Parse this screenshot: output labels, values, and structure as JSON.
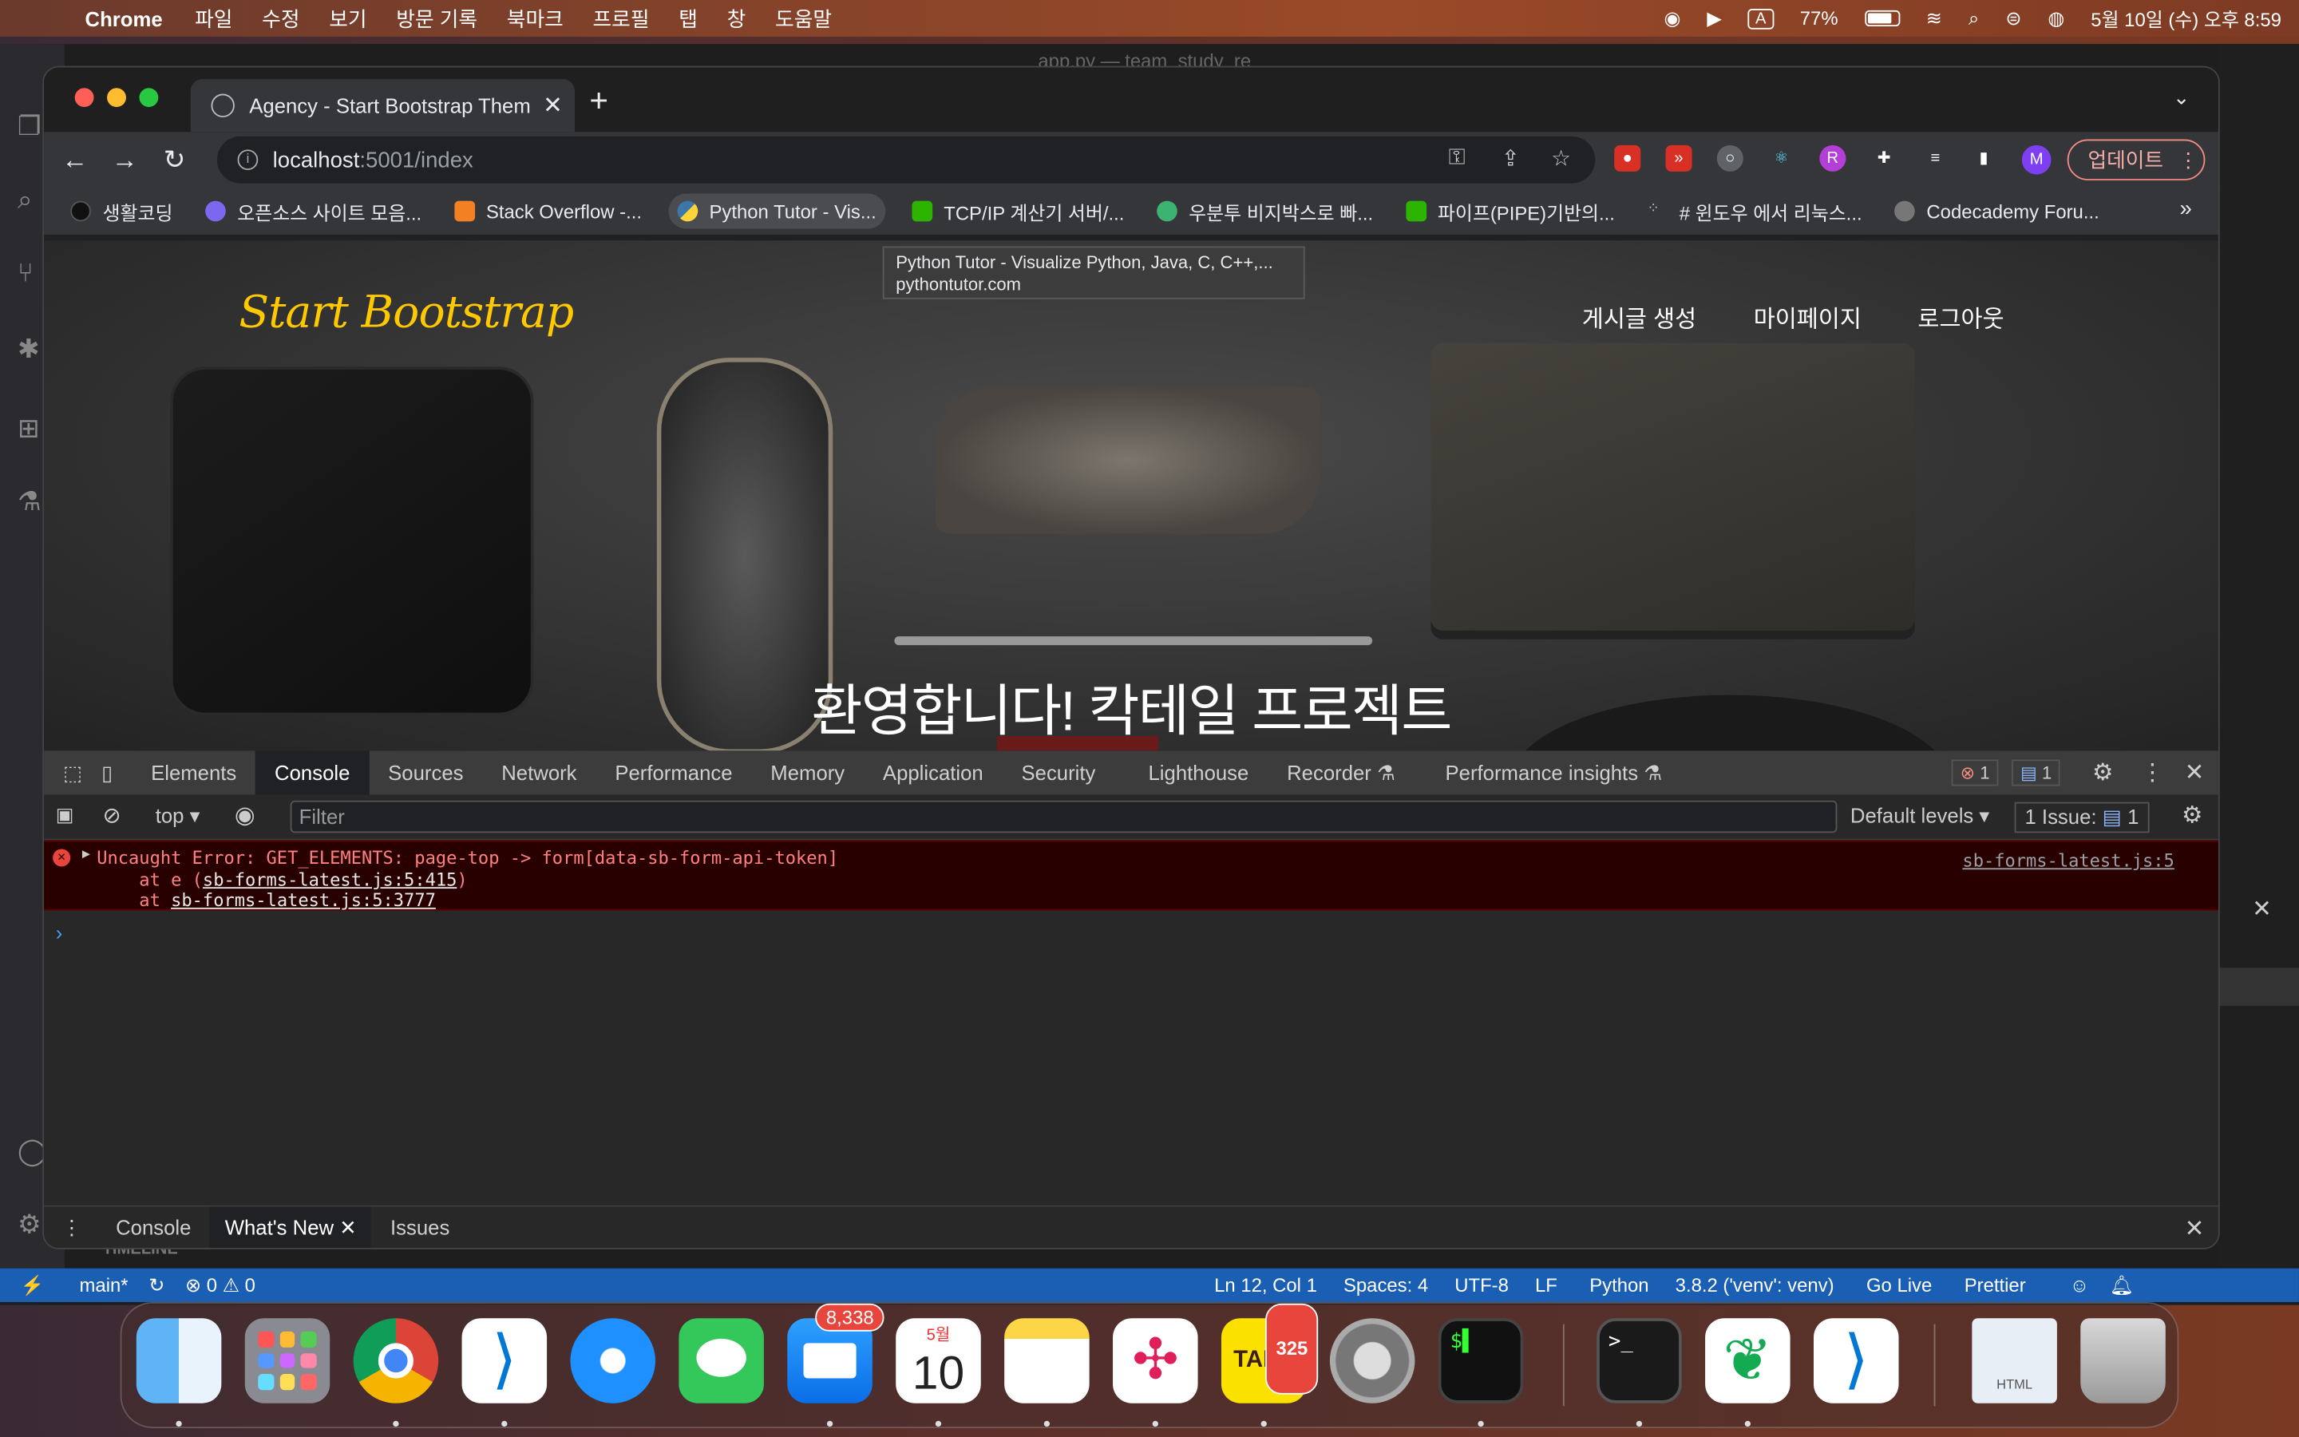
{
  "menubar": {
    "app": "Chrome",
    "items": [
      "파일",
      "수정",
      "보기",
      "방문 기록",
      "북마크",
      "프로필",
      "탭",
      "창",
      "도움말"
    ],
    "battery": "77%",
    "input": "A",
    "datetime": "5월 10일 (수) 오후 8:59"
  },
  "vscode": {
    "title": "app.py — team_study_re",
    "timeline": "TIMELINE",
    "status": {
      "branch": "main*",
      "problems": "⊗ 0 ⚠ 0",
      "position": "Ln 12, Col 1",
      "spaces": "Spaces: 4",
      "encoding": "UTF-8",
      "eol": "LF",
      "language": "Python",
      "interpreter": "3.8.2 ('venv': venv)",
      "golive": "Go Live",
      "prettier": "Prettier"
    }
  },
  "chrome": {
    "tab_title": "Agency - Start Bootstrap Them",
    "url_host": "localhost",
    "url_path": ":5001/index",
    "update": "업데이트",
    "profile": "M",
    "bookmarks": [
      "생활코딩",
      "오픈소스 사이트 모음...",
      "Stack Overflow -...",
      "Python Tutor - Vis...",
      "TCP/IP 계산기 서버/...",
      "우분투 비지박스로 빠...",
      "파이프(PIPE)기반의...",
      "# 윈도우 에서 리눅스...",
      "Codecademy Foru..."
    ],
    "tooltip": {
      "title": "Python Tutor - Visualize Python, Java, C, C++,...",
      "domain": "pythontutor.com"
    }
  },
  "page": {
    "brand": "Start Bootstrap",
    "nav": [
      "게시글 생성",
      "마이페이지",
      "로그아웃"
    ],
    "hero": "환영합니다! 칵테일 프로젝트"
  },
  "devtools": {
    "tabs": [
      "Elements",
      "Console",
      "Sources",
      "Network",
      "Performance",
      "Memory",
      "Application",
      "Security",
      "Lighthouse",
      "Recorder ⚗",
      "Performance insights ⚗"
    ],
    "errors": "1",
    "messages": "1",
    "context": "top",
    "filter_placeholder": "Filter",
    "levels": "Default levels ▾",
    "issues": "1 Issue:",
    "issues_count": "1",
    "error": {
      "line1": "Uncaught Error: GET_ELEMENTS: page-top -> form[data-sb-form-api-token]",
      "line2a": "    at e (",
      "line2b": "sb-forms-latest.js:5:415",
      "line2c": ")",
      "line3a": "    at ",
      "line3b": "sb-forms-latest.js:5:3777",
      "source": "sb-forms-latest.js:5"
    },
    "drawer": [
      "Console",
      "What's New",
      "Issues"
    ]
  },
  "dock": {
    "mail_badge": "8,338",
    "calendar_month": "5월",
    "calendar_day": "10",
    "kakao_badge": "325",
    "kakao_label": "TALK",
    "file_label": "HTML"
  }
}
